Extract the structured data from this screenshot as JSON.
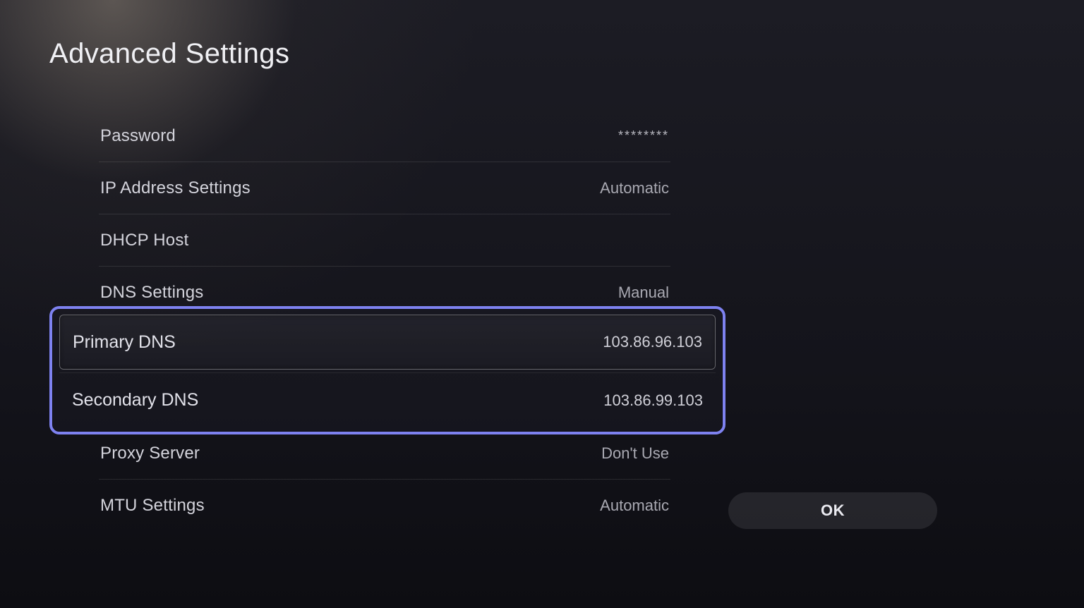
{
  "title": "Advanced Settings",
  "rows": {
    "password": {
      "label": "Password",
      "value": "********"
    },
    "ip": {
      "label": "IP Address Settings",
      "value": "Automatic"
    },
    "dhcp": {
      "label": "DHCP Host",
      "value": ""
    },
    "dns": {
      "label": "DNS Settings",
      "value": "Manual"
    },
    "primary": {
      "label": "Primary DNS",
      "value": "103.86.96.103"
    },
    "secondary": {
      "label": "Secondary DNS",
      "value": "103.86.99.103"
    },
    "proxy": {
      "label": "Proxy Server",
      "value": "Don't Use"
    },
    "mtu": {
      "label": "MTU Settings",
      "value": "Automatic"
    }
  },
  "ok_label": "OK"
}
